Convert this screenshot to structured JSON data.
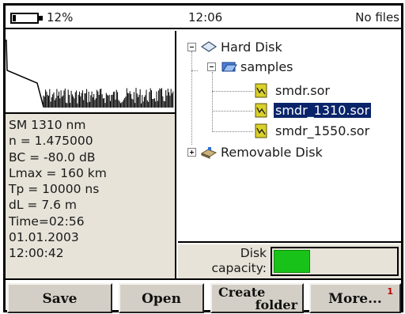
{
  "status": {
    "battery_percent": "12%",
    "battery_level": 0.12,
    "time": "12:06",
    "files_text": "No files"
  },
  "parameters": [
    "SM 1310 nm",
    "n = 1.475000",
    "BC = -80.0 dB",
    "Lmax = 160 km",
    "Tp = 10000 ns",
    "dL = 7.6 m",
    "Time=02:56",
    "01.01.2003",
    "12:00:42"
  ],
  "tree": {
    "hard_disk": "Hard Disk",
    "samples": "samples",
    "files": [
      "smdr.sor",
      "smdr_1310.sor",
      "smdr_1550.sor"
    ],
    "selected_file": "smdr_1310.sor",
    "removable_disk": "Removable Disk"
  },
  "disk": {
    "label_line1": "Disk",
    "label_line2": "capacity:",
    "used_fraction": 0.3,
    "bar_color": "#19c219"
  },
  "buttons": {
    "save": "Save",
    "open": "Open",
    "create_line1": "Create",
    "create_line2": "folder",
    "more": "More...",
    "more_badge": "1"
  },
  "colors": {
    "selection": "#0a246a",
    "panel_bg": "#e7e3d8",
    "button_bg": "#d4cfc6"
  },
  "icons": {
    "hard_disk": "hard-disk-icon",
    "samples": "folder-open-icon",
    "file": "sor-file-icon",
    "removable": "removable-disk-icon"
  }
}
